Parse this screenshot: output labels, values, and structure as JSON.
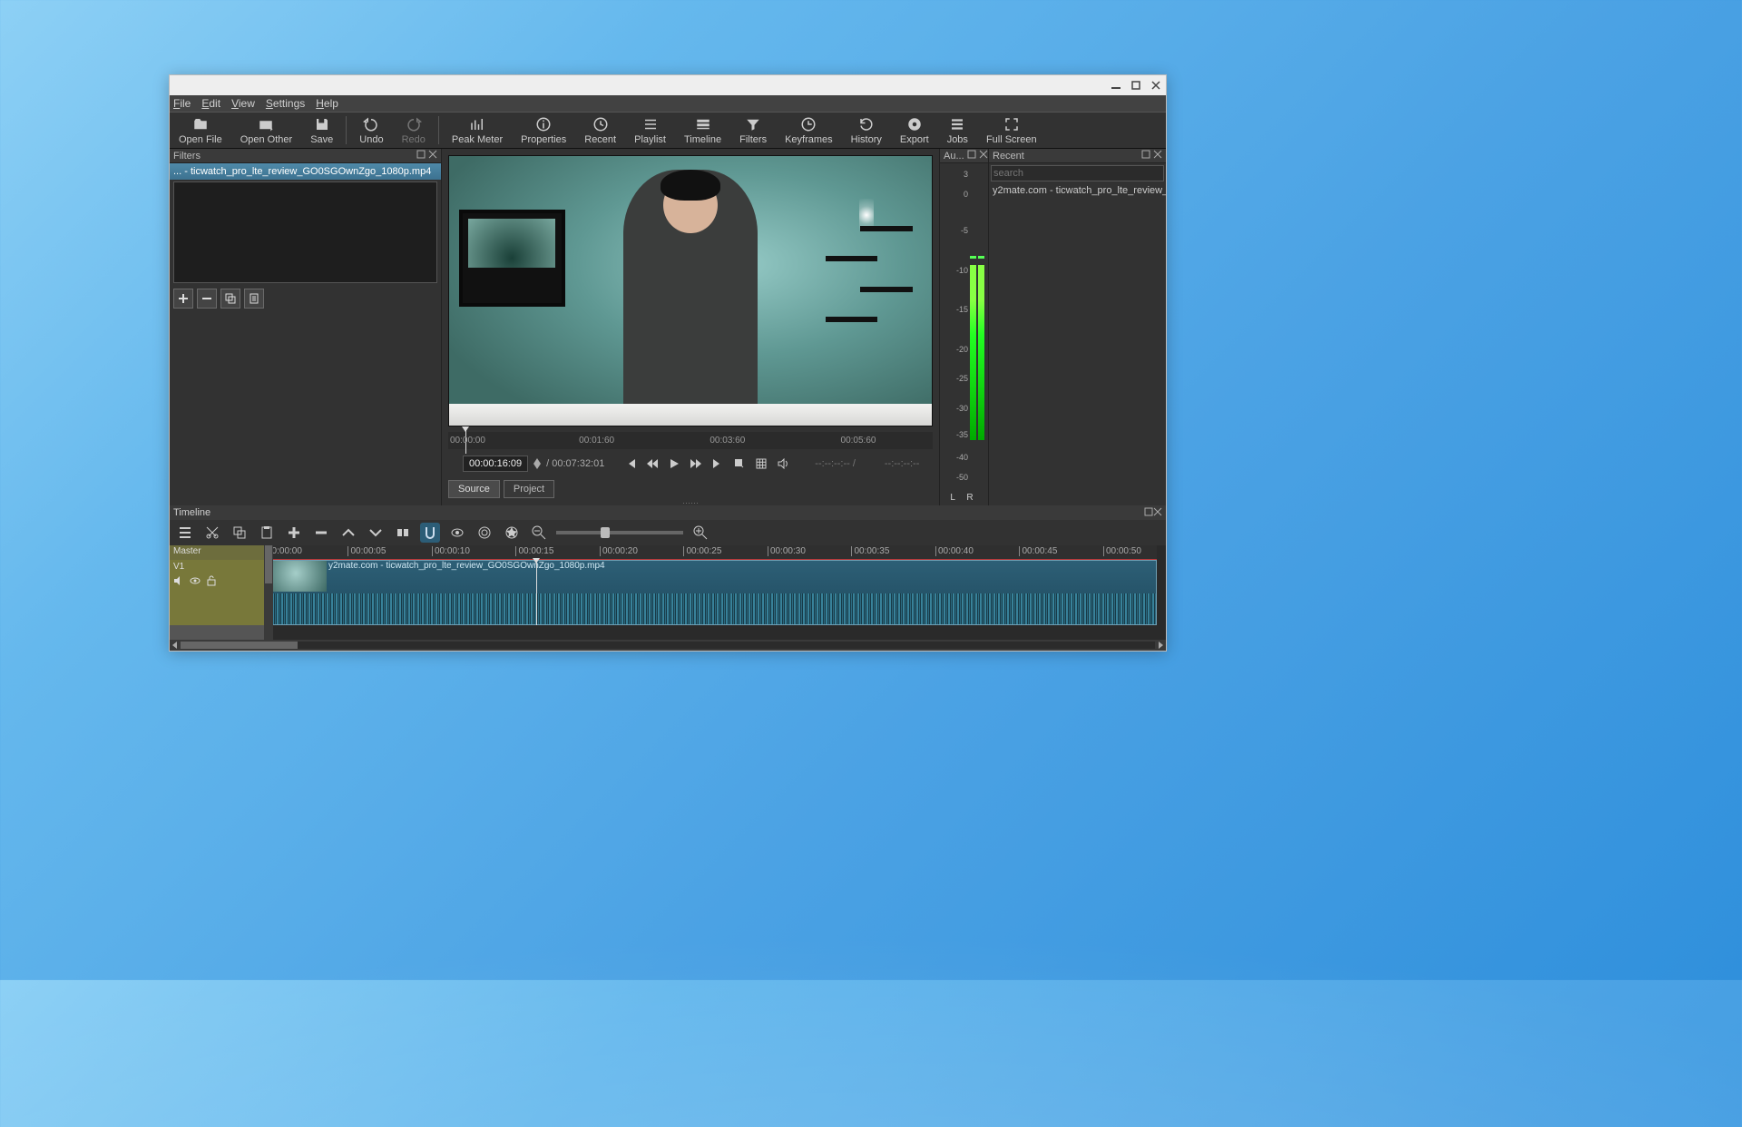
{
  "menu": {
    "file": "File",
    "edit": "Edit",
    "view": "View",
    "settings": "Settings",
    "help": "Help"
  },
  "toolbar": {
    "open_file": "Open File",
    "open_other": "Open Other",
    "save": "Save",
    "undo": "Undo",
    "redo": "Redo",
    "peak_meter": "Peak Meter",
    "properties": "Properties",
    "recent": "Recent",
    "playlist": "Playlist",
    "timeline": "Timeline",
    "filters": "Filters",
    "keyframes": "Keyframes",
    "history": "History",
    "export": "Export",
    "jobs": "Jobs",
    "full_screen": "Full Screen"
  },
  "filters": {
    "title": "Filters",
    "current_file": "... - ticwatch_pro_lte_review_GO0SGOwnZgo_1080p.mp4"
  },
  "preview": {
    "scrub_marks": [
      "00:00:00",
      "00:01:60",
      "00:03:60",
      "00:05:60"
    ],
    "time_current": "00:00:16:09",
    "time_total": "/ 00:07:32:01",
    "inout": "--:--:--:-- /",
    "inout2": "--:--:--:--",
    "tab_source": "Source",
    "tab_project": "Project"
  },
  "aumeter": {
    "title": "Au...",
    "labels": [
      "3",
      "0",
      "-5",
      "-10",
      "-15",
      "-20",
      "-25",
      "-30",
      "-35",
      "-40",
      "-50"
    ],
    "lr": "L  R"
  },
  "recent": {
    "title": "Recent",
    "search_placeholder": "search",
    "items": [
      "y2mate.com - ticwatch_pro_lte_review_..."
    ]
  },
  "timeline": {
    "title": "Timeline",
    "master": "Master",
    "track": "V1",
    "ruler": [
      "00:00:00",
      "00:00:05",
      "00:00:10",
      "00:00:15",
      "00:00:20",
      "00:00:25",
      "00:00:30",
      "00:00:35",
      "00:00:40",
      "00:00:45",
      "00:00:50"
    ],
    "clip_label": "y2mate.com - ticwatch_pro_lte_review_GO0SGOwnZgo_1080p.mp4"
  }
}
